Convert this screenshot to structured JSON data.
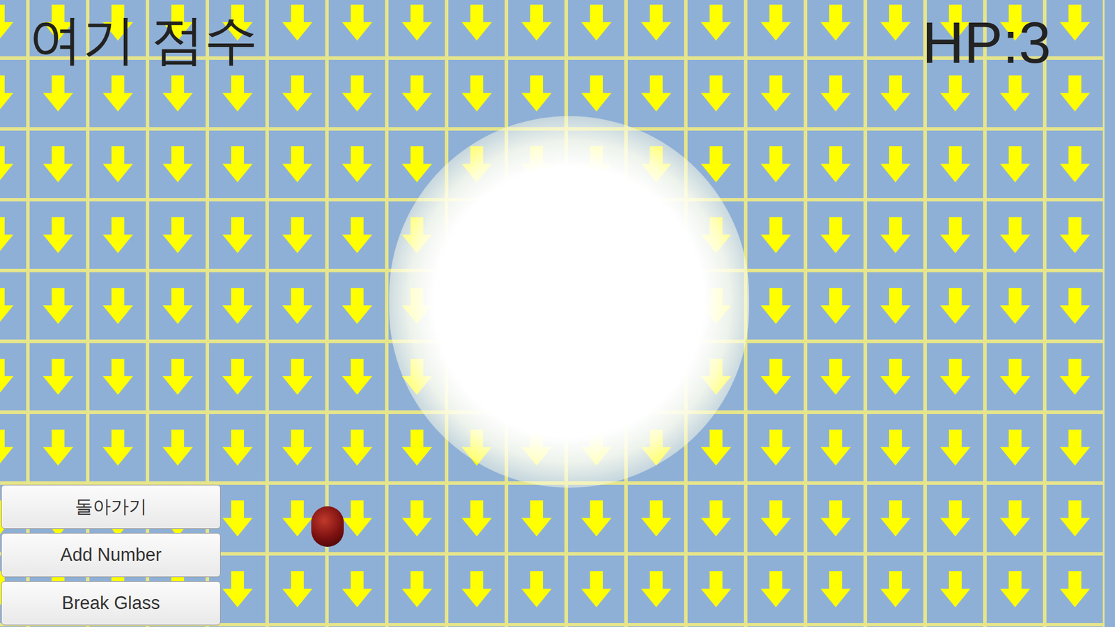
{
  "hud": {
    "score_label": "여기 점수",
    "hp": "HP:3"
  },
  "buttons": [
    "돌아가기",
    "Add Number",
    "Break Glass"
  ]
}
